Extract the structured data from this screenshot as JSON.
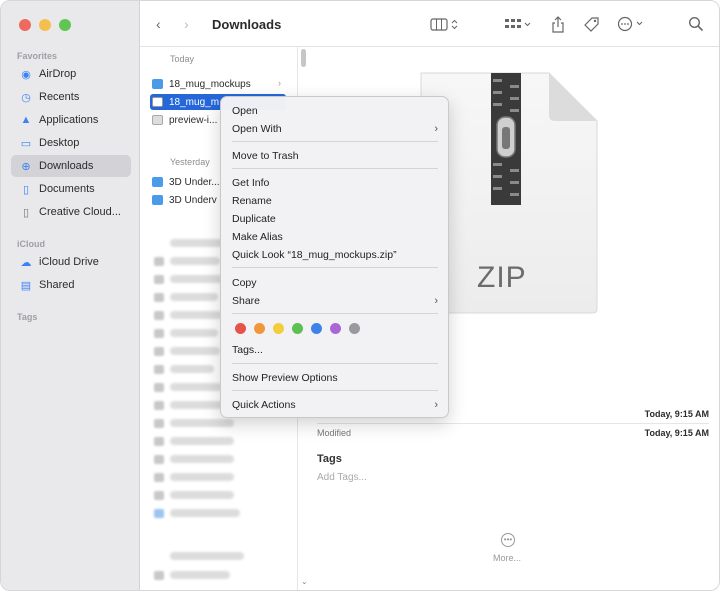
{
  "window": {
    "title": "Downloads"
  },
  "sidebar": {
    "sections": {
      "favorites": "Favorites",
      "icloud": "iCloud",
      "tags": "Tags"
    },
    "items": [
      {
        "label": "AirDrop",
        "icon": "airdrop-icon"
      },
      {
        "label": "Recents",
        "icon": "clock-icon"
      },
      {
        "label": "Applications",
        "icon": "applications-icon"
      },
      {
        "label": "Desktop",
        "icon": "desktop-icon"
      },
      {
        "label": "Downloads",
        "icon": "download-icon",
        "active": true
      },
      {
        "label": "Documents",
        "icon": "document-icon"
      },
      {
        "label": "Creative Cloud...",
        "icon": "document-icon"
      }
    ],
    "icloud_items": [
      {
        "label": "iCloud Drive",
        "icon": "cloud-icon"
      },
      {
        "label": "Shared",
        "icon": "shared-folder-icon"
      }
    ]
  },
  "filelist": {
    "groups": {
      "today": "Today",
      "yesterday": "Yesterday"
    },
    "today": [
      {
        "label": "18_mug_mockups",
        "icon": "folder-icon"
      },
      {
        "label": "18_mug_m",
        "icon": "zip-file-icon",
        "selected": true
      },
      {
        "label": "preview-i...",
        "icon": "document-icon"
      }
    ],
    "yesterday": [
      {
        "label": "3D Under...",
        "icon": "folder-icon"
      },
      {
        "label": "3D Underv",
        "icon": "folder-icon"
      }
    ]
  },
  "preview": {
    "zip_label": "ZIP",
    "created_value": "Today, 9:15 AM",
    "modified_label": "Modified",
    "modified_value": "Today, 9:15 AM",
    "tags_heading": "Tags",
    "tags_placeholder": "Add Tags...",
    "more_label": "More..."
  },
  "context_menu": {
    "items": {
      "open": "Open",
      "open_with": "Open With",
      "move_to_trash": "Move to Trash",
      "get_info": "Get Info",
      "rename": "Rename",
      "duplicate": "Duplicate",
      "make_alias": "Make Alias",
      "quick_look": "Quick Look “18_mug_mockups.zip”",
      "copy": "Copy",
      "share": "Share",
      "tags": "Tags...",
      "show_preview_options": "Show Preview Options",
      "quick_actions": "Quick Actions"
    },
    "tag_colors": [
      "#e5534b",
      "#f0973a",
      "#f3cd3b",
      "#5cc052",
      "#3f82e8",
      "#a967d6",
      "#9a9a9e"
    ]
  }
}
